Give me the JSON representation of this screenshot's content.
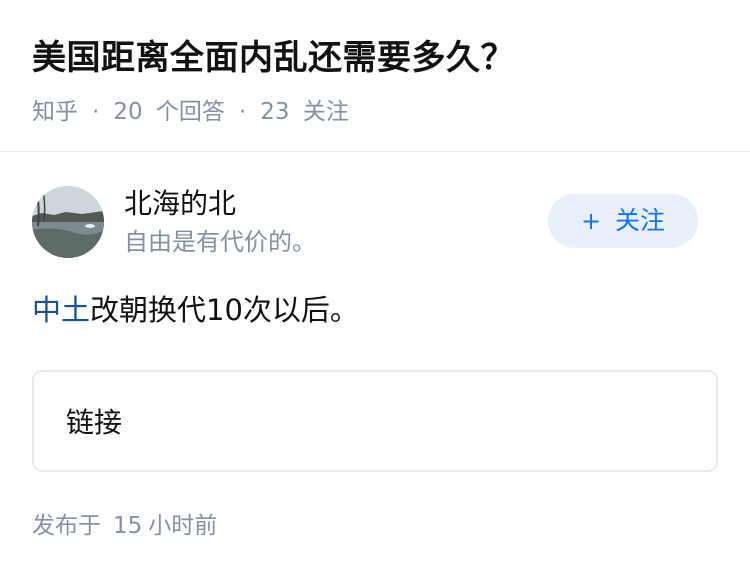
{
  "question": {
    "title": "美国距离全面内乱还需要多久？",
    "source": "知乎",
    "separator": "·",
    "answer_count": "20",
    "answer_label": "个回答",
    "follower_count": "23",
    "follower_label": "关注"
  },
  "author": {
    "name": "北海的北",
    "bio": "自由是有代价的。",
    "follow_plus": "+",
    "follow_label": "关注"
  },
  "answer": {
    "link_text": "中土",
    "body_text": "改朝换代10次以后。",
    "link_card_label": "链接"
  },
  "footer": {
    "published_label": "发布于",
    "published_count": "15",
    "published_unit": "小时前"
  },
  "colors": {
    "accent": "#1772f6",
    "link": "#175199",
    "muted": "#8590a6",
    "follow_bg": "#e8f1fb"
  }
}
